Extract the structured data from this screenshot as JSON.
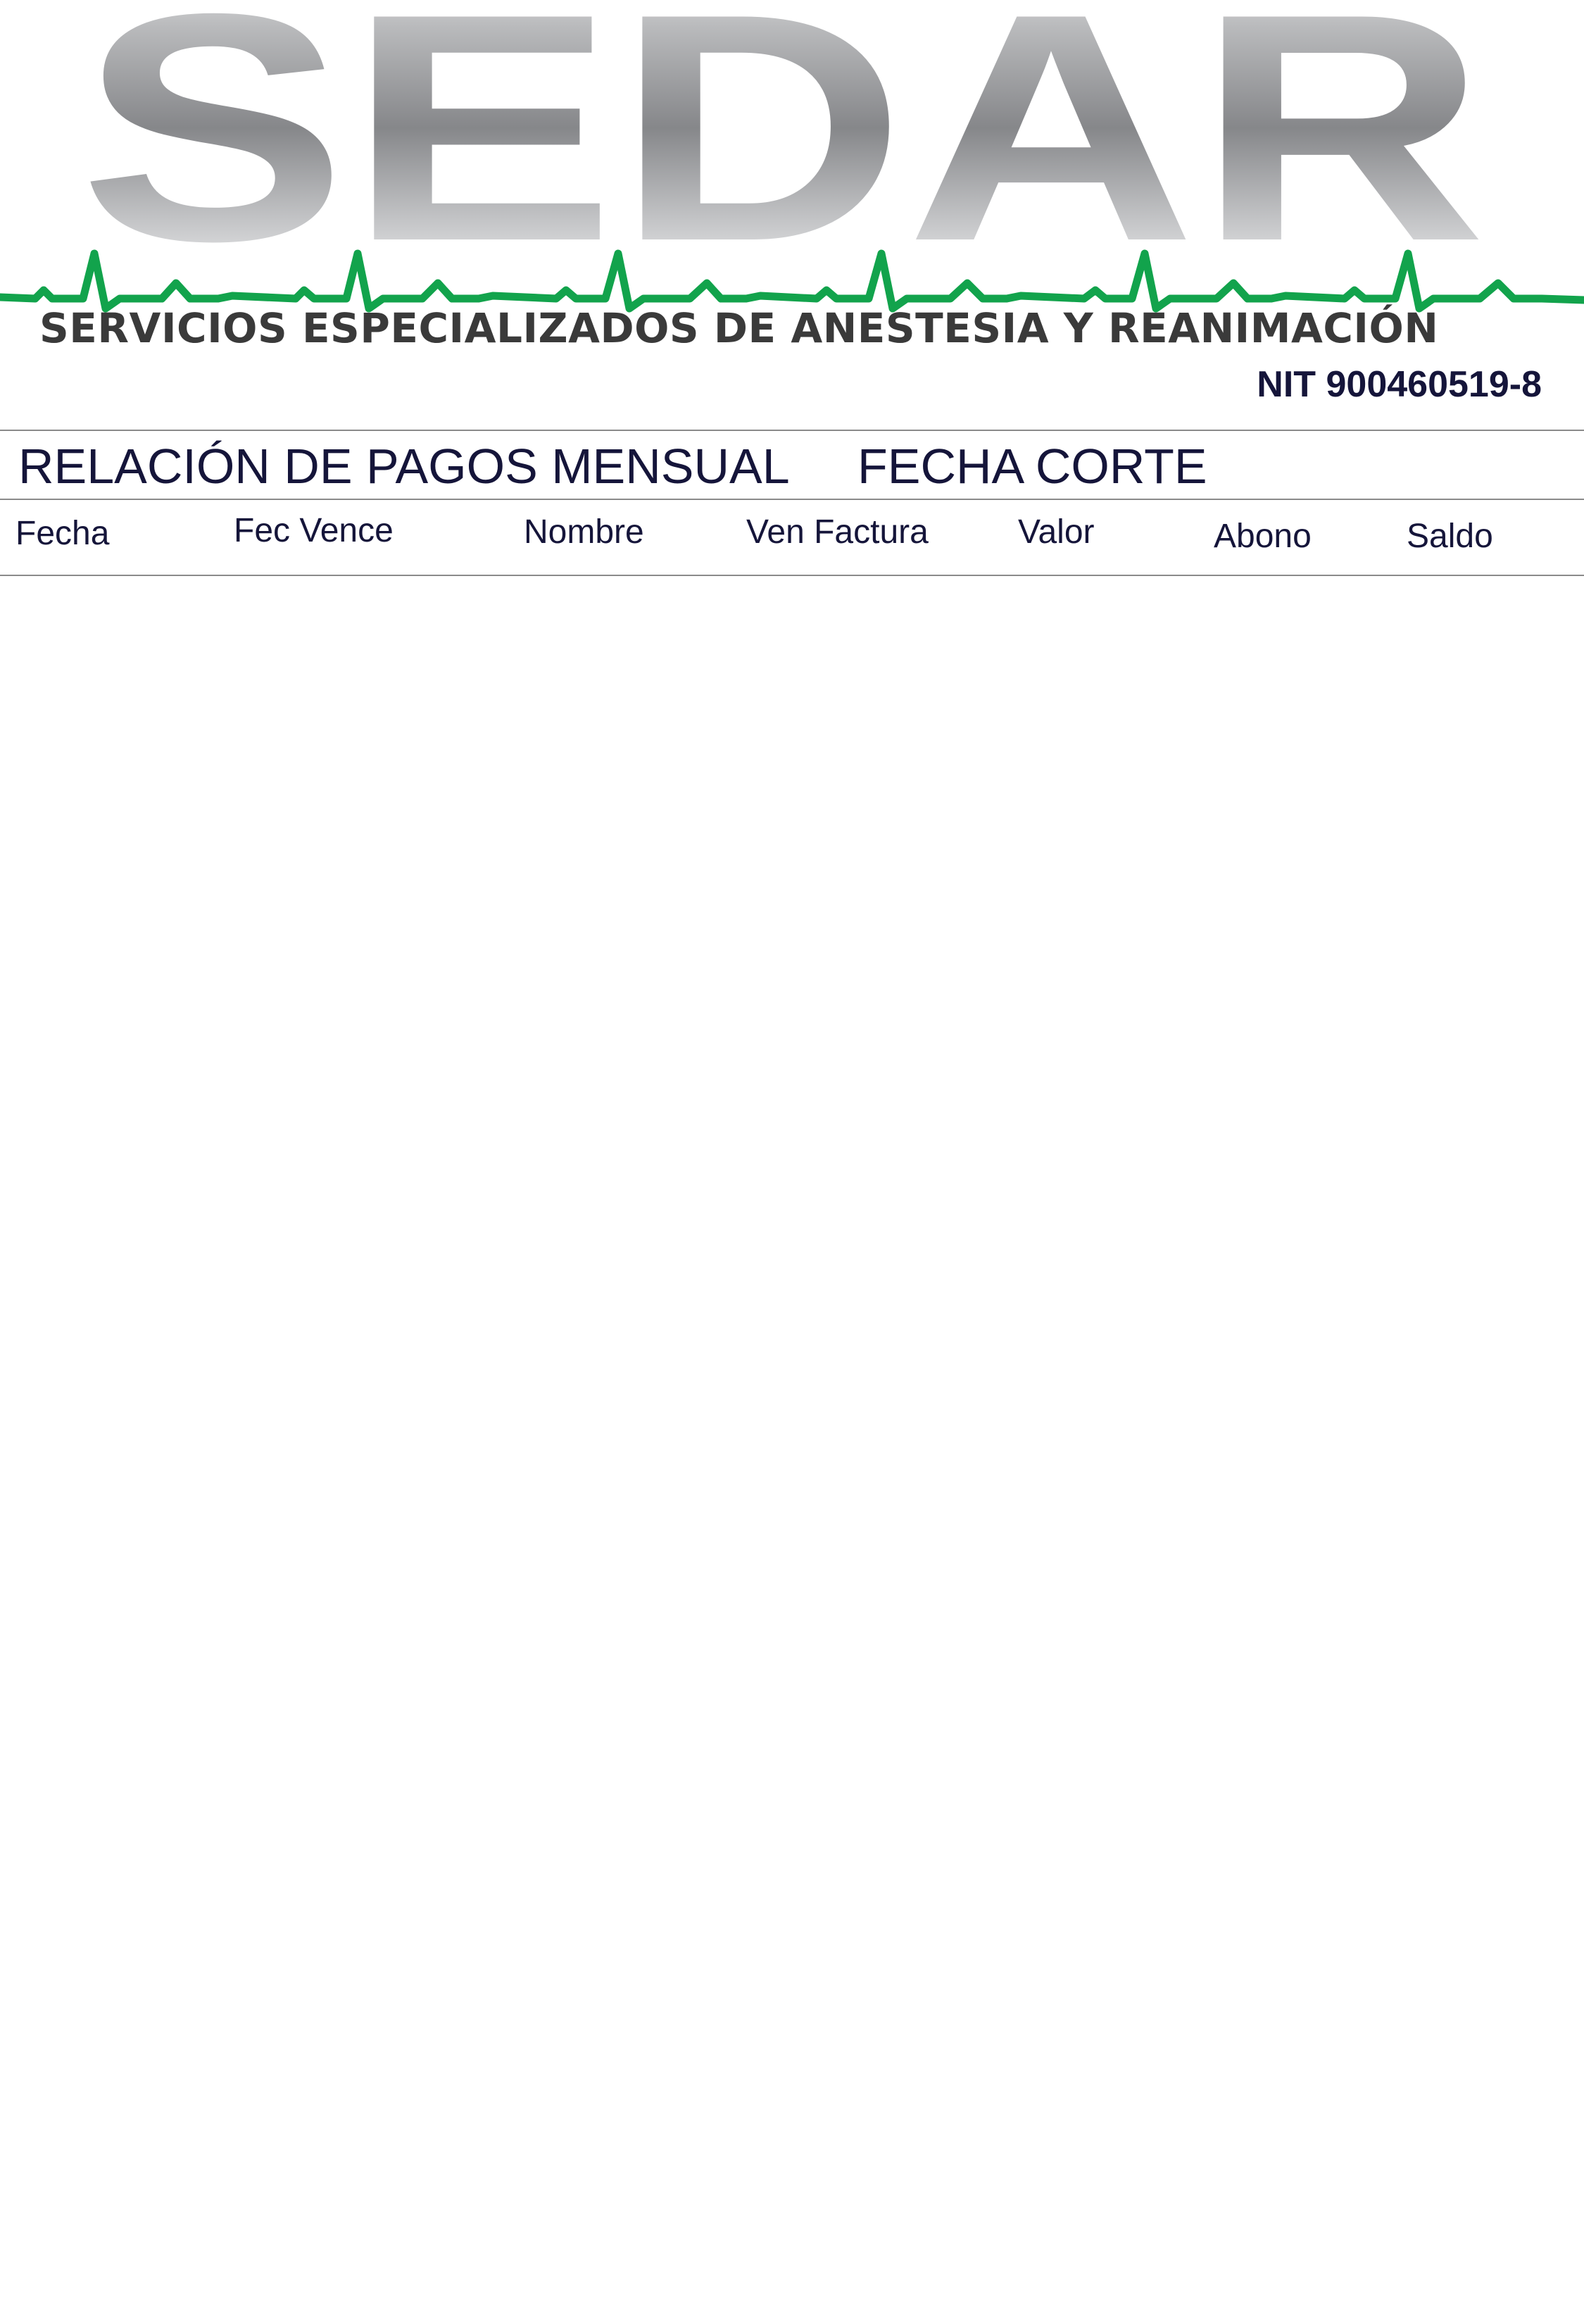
{
  "header": {
    "logo_text": "SEDAR",
    "tagline": "SERVICIOS ESPECIALIZADOS DE ANESTESIA Y REANIMACIÓN",
    "nit": "NIT 900460519-8"
  },
  "report": {
    "title": "RELACIÓN DE PAGOS MENSUAL",
    "cutoff_label": "FECHA CORTE"
  },
  "table": {
    "columns": [
      "Fecha",
      "Fec Vence",
      "Nombre",
      "Ven Factura",
      "Valor",
      "Abono",
      "Saldo"
    ]
  },
  "colors": {
    "heartbeat_line": "#12a34c",
    "logo_gray": "#8e8f92",
    "title_text": "#15153a",
    "tagline_text": "#3a3a3a"
  }
}
